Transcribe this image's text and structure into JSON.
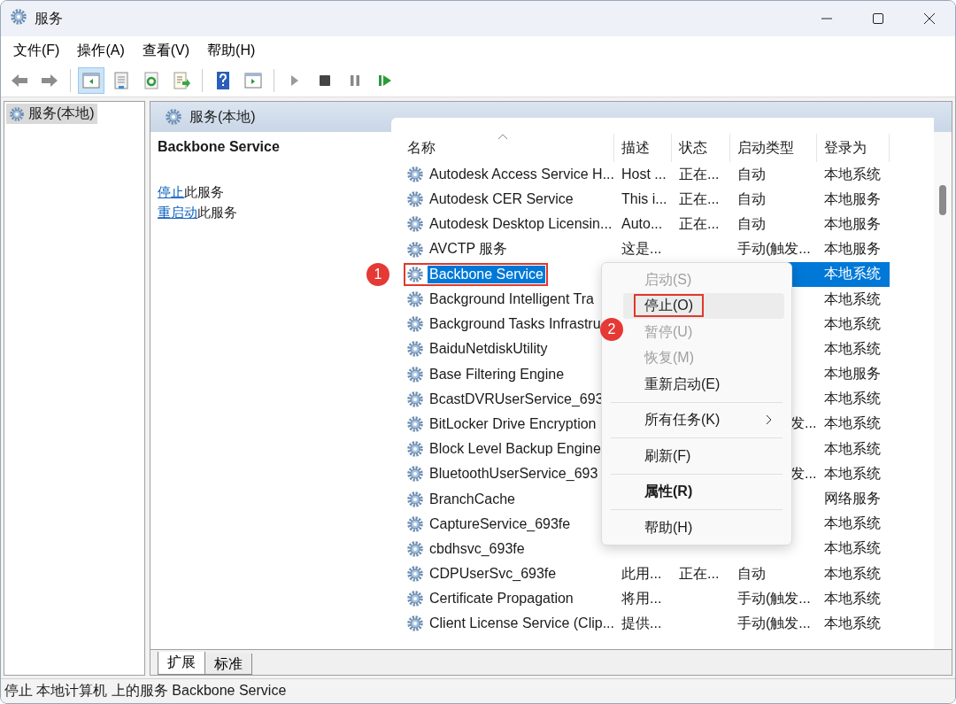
{
  "window": {
    "title": "服务"
  },
  "menu": [
    "文件(F)",
    "操作(A)",
    "查看(V)",
    "帮助(H)"
  ],
  "toolbar": [
    {
      "kind": "back",
      "pressed": false
    },
    {
      "kind": "forward",
      "pressed": false
    },
    {
      "kind": "separator"
    },
    {
      "kind": "tree",
      "pressed": true
    },
    {
      "kind": "sheet",
      "pressed": false
    },
    {
      "kind": "refresh",
      "pressed": false
    },
    {
      "kind": "export",
      "pressed": false
    },
    {
      "kind": "separator"
    },
    {
      "kind": "help",
      "pressed": false
    },
    {
      "kind": "pane",
      "pressed": false
    },
    {
      "kind": "separator"
    },
    {
      "kind": "play",
      "pressed": false
    },
    {
      "kind": "stop",
      "pressed": false
    },
    {
      "kind": "pause",
      "pressed": false
    },
    {
      "kind": "resume",
      "pressed": false
    }
  ],
  "tree": [
    {
      "label": "服务(本地)",
      "selected": true
    }
  ],
  "panel": {
    "title": "服务(本地)",
    "service_name": "Backbone Service",
    "actions": [
      {
        "link": "停止",
        "text": "此服务"
      },
      {
        "link": "重启动",
        "text": "此服务"
      }
    ]
  },
  "table": {
    "columns": [
      {
        "label": "名称",
        "sorted": true
      },
      {
        "label": "描述",
        "sorted": false
      },
      {
        "label": "状态",
        "sorted": false
      },
      {
        "label": "启动类型",
        "sorted": false
      },
      {
        "label": "登录为",
        "sorted": false
      }
    ],
    "rows": [
      {
        "name": "Autodesk Access Service H...",
        "description": "Host ...",
        "status": "正在...",
        "startup": "自动",
        "logon": "本地系统",
        "selected": false
      },
      {
        "name": "Autodesk CER Service",
        "description": "This i...",
        "status": "正在...",
        "startup": "自动",
        "logon": "本地服务",
        "selected": false
      },
      {
        "name": "Autodesk Desktop Licensin...",
        "description": "Auto...",
        "status": "正在...",
        "startup": "自动",
        "logon": "本地服务",
        "selected": false
      },
      {
        "name": "AVCTP 服务",
        "description": "这是...",
        "startup": "手动(触发...",
        "logon": "本地服务",
        "selected": false
      },
      {
        "name": "Backbone Service",
        "logon": "本地系统",
        "selected": true,
        "outlined": true,
        "marker": "1"
      },
      {
        "name": "Background Intelligent Tra",
        "logon": "本地系统",
        "selected": false
      },
      {
        "name": "Background Tasks Infrastru",
        "logon": "本地系统",
        "selected": false
      },
      {
        "name": "BaiduNetdiskUtility",
        "logon": "本地系统",
        "selected": false
      },
      {
        "name": "Base Filtering Engine",
        "logon": "本地服务",
        "selected": false
      },
      {
        "name": "BcastDVRUserService_693",
        "logon": "本地系统",
        "selected": false
      },
      {
        "name": "BitLocker Drive Encryption",
        "startup": "发...",
        "startup_clipped": true,
        "logon": "本地系统",
        "selected": false
      },
      {
        "name": "Block Level Backup Engine",
        "logon": "本地系统",
        "selected": false
      },
      {
        "name": "BluetoothUserService_693",
        "startup": "发...",
        "startup_clipped": true,
        "logon": "本地系统",
        "selected": false
      },
      {
        "name": "BranchCache",
        "logon": "网络服务",
        "selected": false
      },
      {
        "name": "CaptureService_693fe",
        "logon": "本地系统",
        "selected": false
      },
      {
        "name": "cbdhsvc_693fe",
        "logon": "本地系统",
        "selected": false
      },
      {
        "name": "CDPUserSvc_693fe",
        "description": "此用...",
        "status": "正在...",
        "startup": "自动",
        "logon": "本地系统",
        "selected": false
      },
      {
        "name": "Certificate Propagation",
        "description": "将用...",
        "startup": "手动(触发...",
        "logon": "本地系统",
        "selected": false
      },
      {
        "name": "Client License Service (Clip...",
        "description": "提供...",
        "startup": "手动(触发...",
        "logon": "本地系统",
        "selected": false
      }
    ]
  },
  "context_menu": [
    {
      "kind": "item",
      "label": "启动(S)",
      "disabled": true,
      "highlighted": false,
      "outlined": false,
      "bold": false,
      "submenu": false
    },
    {
      "kind": "item",
      "label": "停止(O)",
      "disabled": false,
      "highlighted": true,
      "outlined": true,
      "bold": false,
      "submenu": false,
      "marker": "2"
    },
    {
      "kind": "item",
      "label": "暂停(U)",
      "disabled": true,
      "highlighted": false,
      "outlined": false,
      "bold": false,
      "submenu": false
    },
    {
      "kind": "item",
      "label": "恢复(M)",
      "disabled": true,
      "highlighted": false,
      "outlined": false,
      "bold": false,
      "submenu": false
    },
    {
      "kind": "item",
      "label": "重新启动(E)",
      "disabled": false,
      "highlighted": false,
      "outlined": false,
      "bold": false,
      "submenu": false
    },
    {
      "kind": "separator"
    },
    {
      "kind": "item",
      "label": "所有任务(K)",
      "disabled": false,
      "highlighted": false,
      "outlined": false,
      "bold": false,
      "submenu": true
    },
    {
      "kind": "separator"
    },
    {
      "kind": "item",
      "label": "刷新(F)",
      "disabled": false,
      "highlighted": false,
      "outlined": false,
      "bold": false,
      "submenu": false
    },
    {
      "kind": "separator"
    },
    {
      "kind": "item",
      "label": "属性(R)",
      "disabled": false,
      "highlighted": false,
      "outlined": false,
      "bold": true,
      "submenu": false
    },
    {
      "kind": "separator"
    },
    {
      "kind": "item",
      "label": "帮助(H)",
      "disabled": false,
      "highlighted": false,
      "outlined": false,
      "bold": false,
      "submenu": false
    }
  ],
  "tabs": [
    {
      "label": "扩展",
      "selected": true
    },
    {
      "label": "标准",
      "selected": false
    }
  ],
  "status_bar": "停止 本地计算机 上的服务 Backbone Service"
}
